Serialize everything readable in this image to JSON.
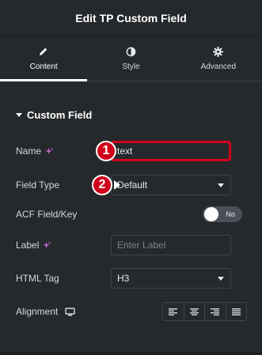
{
  "header": {
    "title": "Edit TP Custom Field"
  },
  "tabs": [
    {
      "label": "Content",
      "icon": "pencil-icon",
      "active": true
    },
    {
      "label": "Style",
      "icon": "contrast-icon",
      "active": false
    },
    {
      "label": "Advanced",
      "icon": "gear-icon",
      "active": false
    }
  ],
  "section": {
    "title": "Custom Field",
    "expanded": true
  },
  "fields": {
    "name": {
      "label": "Name",
      "value": "text",
      "badge": "1"
    },
    "field_type": {
      "label": "Field Type",
      "value": "Default",
      "badge": "2"
    },
    "acf_key": {
      "label": "ACF Field/Key",
      "toggle_text": "No",
      "enabled": false
    },
    "label": {
      "label": "Label",
      "placeholder": "Enter Label"
    },
    "html_tag": {
      "label": "HTML Tag",
      "value": "H3"
    },
    "alignment": {
      "label": "Alignment",
      "options": [
        "align-left-icon",
        "align-center-icon",
        "align-right-icon",
        "align-justify-icon"
      ]
    }
  },
  "colors": {
    "accent_badge": "#d0021b",
    "panel_bg": "#26292c"
  }
}
